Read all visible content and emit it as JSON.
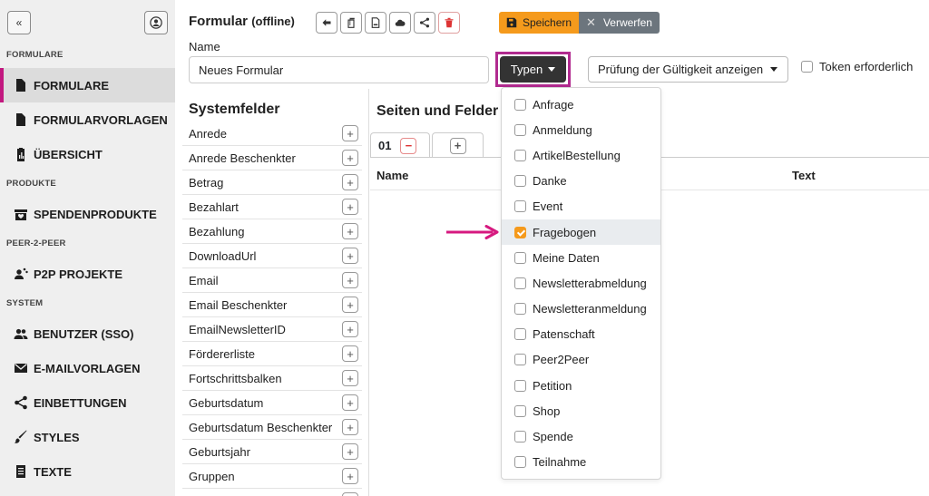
{
  "sidebar": {
    "sections": {
      "formulare": "FORMULARE",
      "produkte": "PRODUKTE",
      "p2p": "PEER-2-PEER",
      "system": "SYSTEM"
    },
    "items": {
      "formulare": "FORMULARE",
      "formularvorlagen": "FORMULARVORLAGEN",
      "uebersicht": "ÜBERSICHT",
      "spendenprodukte": "SPENDENPRODUKTE",
      "p2p_projekte": "P2P PROJEKTE",
      "benutzer": "BENUTZER (SSO)",
      "emailvorlagen": "E-MAILVORLAGEN",
      "einbettungen": "EINBETTUNGEN",
      "styles": "STYLES",
      "texte": "TEXTE"
    },
    "active_item": "formulare"
  },
  "header": {
    "title": "Formular",
    "status": "(offline)",
    "save_label": "Speichern",
    "discard_label": "Verwerfen"
  },
  "form": {
    "name_label": "Name",
    "name_value": "Neues Formular",
    "typen_label": "Typen",
    "validation_label": "Prüfung der Gültigkeit anzeigen",
    "token_label": "Token erforderlich"
  },
  "systemfelder": {
    "title": "Systemfelder",
    "fields": [
      "Anrede",
      "Anrede Beschenkter",
      "Betrag",
      "Bezahlart",
      "Bezahlung",
      "DownloadUrl",
      "Email",
      "Email Beschenkter",
      "EmailNewsletterID",
      "Fördererliste",
      "Fortschrittsbalken",
      "Geburtsdatum",
      "Geburtsdatum Beschenkter",
      "Geburtsjahr",
      "Gruppen"
    ]
  },
  "pages": {
    "title": "Seiten und Felder",
    "tab_1": "01",
    "col_name": "Name",
    "col_text": "Text"
  },
  "typen_dropdown": {
    "options": [
      "Anfrage",
      "Anmeldung",
      "ArtikelBestellung",
      "Danke",
      "Event",
      "Fragebogen",
      "Meine Daten",
      "Newsletterabmeldung",
      "Newsletteranmeldung",
      "Patenschaft",
      "Peer2Peer",
      "Petition",
      "Shop",
      "Spende",
      "Teilnahme"
    ],
    "checked": "Fragebogen"
  },
  "colors": {
    "accent_orange": "#f59a1c",
    "highlight_magenta": "#b12a8f",
    "active_bar": "#c2187f",
    "arrow": "#d6197f"
  }
}
